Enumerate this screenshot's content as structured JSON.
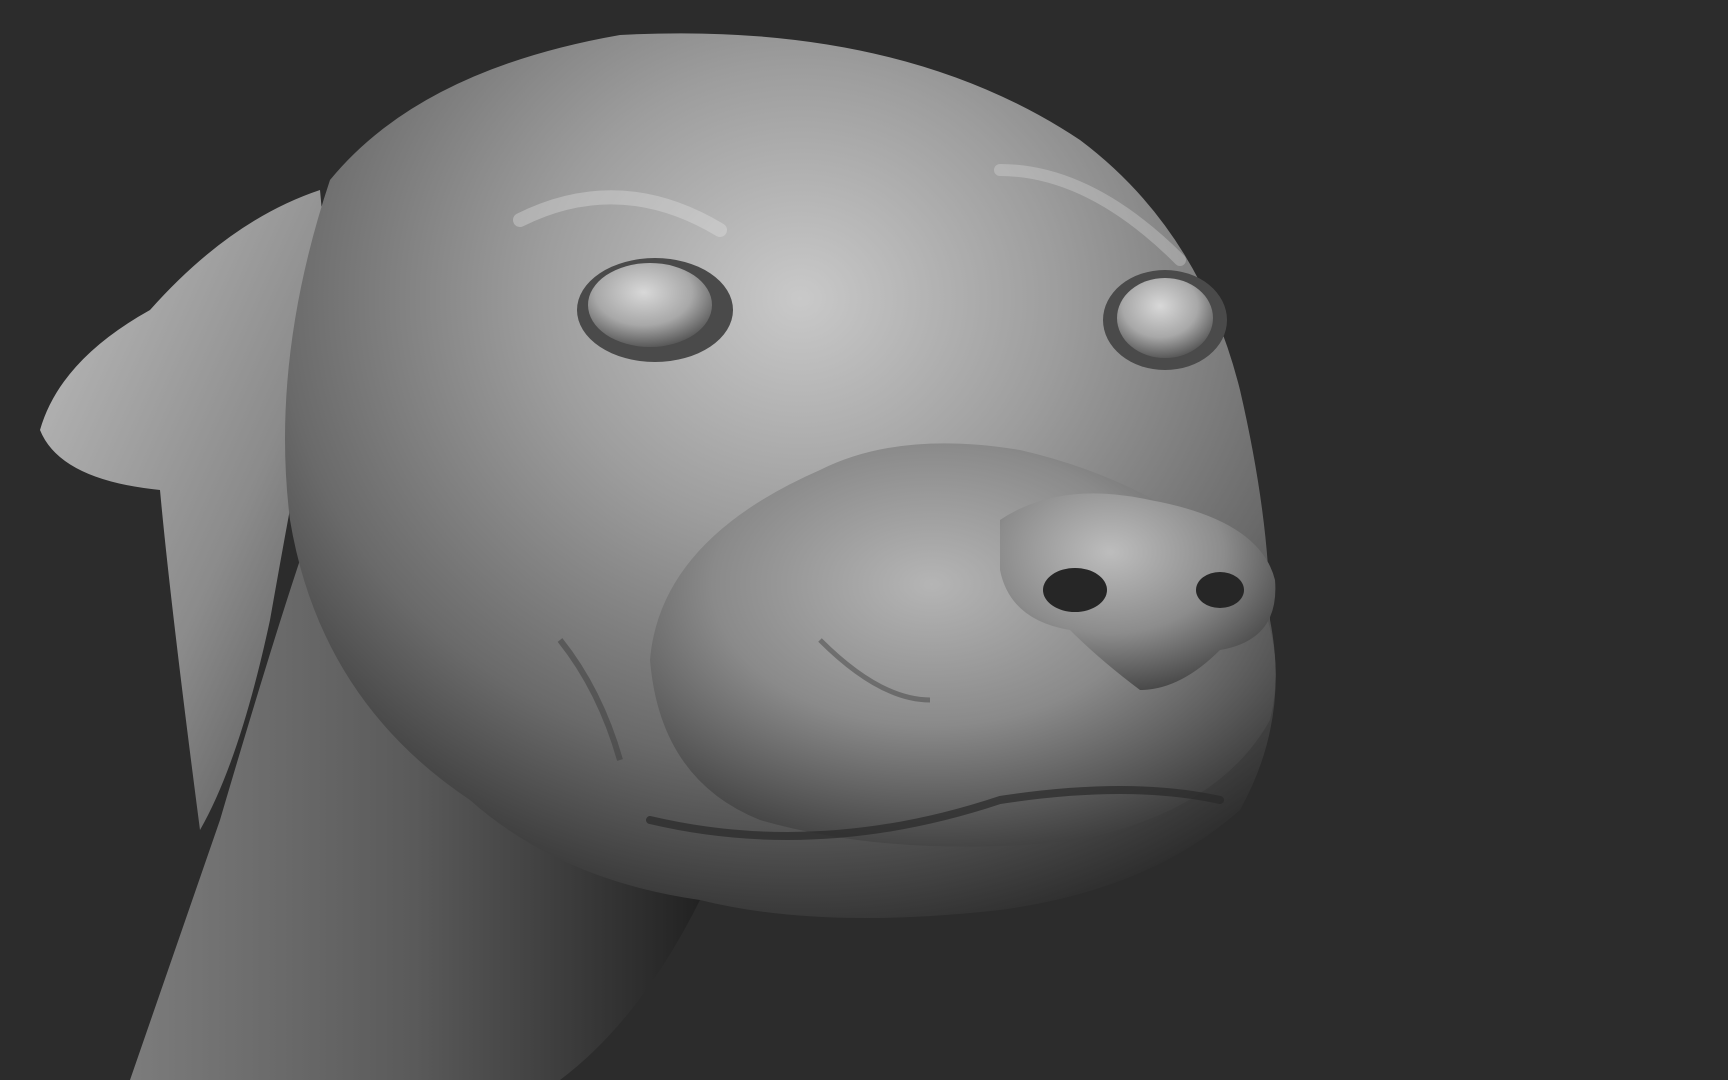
{
  "viewport": {
    "background_color": "#2c2c2c",
    "subject": "sculpted-dog-head",
    "material_color": "#9a9a9a"
  }
}
